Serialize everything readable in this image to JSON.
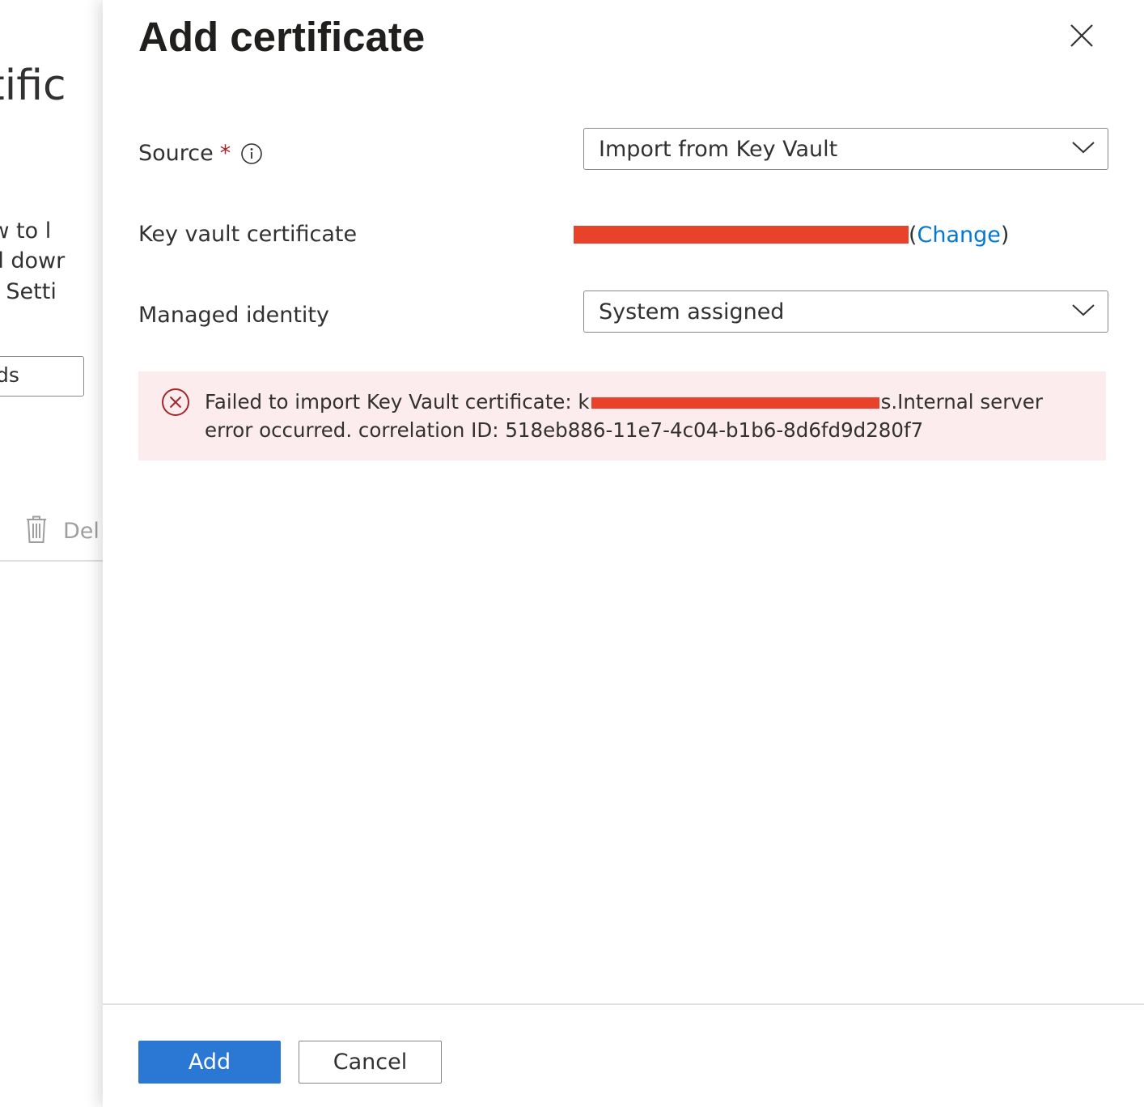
{
  "background_page": {
    "title_fragment": "ertific",
    "lines": [
      "d how to l",
      "anual dowr",
      "l App Setti"
    ],
    "input_fragment": "ds",
    "delete_label": "Del"
  },
  "panel": {
    "title": "Add certificate",
    "close_icon": "close-icon"
  },
  "form": {
    "source": {
      "label": "Source",
      "required_mark": "*",
      "info_icon": "info-icon",
      "value": "Import from Key Vault"
    },
    "key_vault_certificate": {
      "label": "Key vault certificate",
      "open_paren": "(",
      "change_link": "Change",
      "close_paren": ")"
    },
    "managed_identity": {
      "label": "Managed identity",
      "value": "System assigned"
    }
  },
  "error": {
    "icon": "error-circle-icon",
    "prefix": "Failed to import Key Vault certificate: k",
    "suffix": "s.Internal server error occurred. correlation ID: 518eb886-11e7-4c04-b1b6-8d6fd9d280f7"
  },
  "footer": {
    "add_label": "Add",
    "cancel_label": "Cancel"
  },
  "colors": {
    "accent": "#2b78d4",
    "link": "#0078d4",
    "error_bg": "#fdeced",
    "error_icon": "#a4262c",
    "redaction": "#e8432a"
  }
}
